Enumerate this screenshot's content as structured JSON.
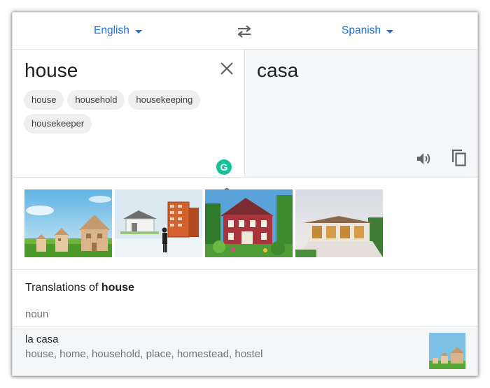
{
  "language_bar": {
    "source_language": "English",
    "target_language": "Spanish",
    "swap_icon": "swap-arrows-icon"
  },
  "source": {
    "text": "house",
    "suggestions": [
      "house",
      "household",
      "housekeeping",
      "housekeeper"
    ],
    "grammarly_letter": "G"
  },
  "target": {
    "text": "casa"
  },
  "images": {
    "count": 4,
    "descriptions": [
      "toy wooden houses on grass",
      "architecture models with figure",
      "red house with garden",
      "modern house exterior"
    ]
  },
  "translations": {
    "title_prefix": "Translations of ",
    "title_word": "house",
    "part_of_speech": "noun",
    "entries": [
      {
        "word": "la casa",
        "synonyms": "house, home, household, place, homestead, hostel"
      }
    ]
  },
  "colors": {
    "accent": "#1a73e8",
    "grammarly": "#15c39a",
    "target_bg": "#f5f6f7"
  }
}
